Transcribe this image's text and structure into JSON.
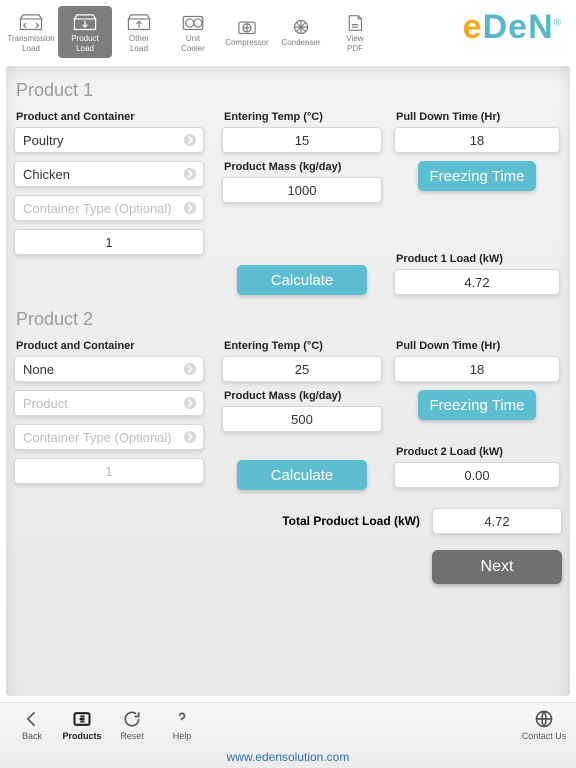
{
  "tabs": [
    {
      "l1": "Transmission",
      "l2": "Load"
    },
    {
      "l1": "Product",
      "l2": "Load"
    },
    {
      "l1": "Other",
      "l2": "Load"
    },
    {
      "l1": "Unit",
      "l2": "Cooler"
    },
    {
      "l1": "Compressor",
      "l2": ""
    },
    {
      "l1": "Condenser",
      "l2": ""
    },
    {
      "l1": "View",
      "l2": "PDF"
    }
  ],
  "active_tab": 1,
  "brand": "eDeN",
  "p1": {
    "title": "Product 1",
    "pc_label": "Product and Container",
    "category": "Poultry",
    "product": "Chicken",
    "container_placeholder": "Container Type (Optional)",
    "qty": "1",
    "et_label": "Entering Temp (°C)",
    "et": "15",
    "pm_label": "Product Mass (kg/day)",
    "pm": "1000",
    "pd_label": "Pull Down Time (Hr)",
    "pd": "18",
    "freeze_btn": "Freezing Time",
    "calc_btn": "Calculate",
    "load_label": "Product 1 Load (kW)",
    "load": "4.72"
  },
  "p2": {
    "title": "Product 2",
    "pc_label": "Product and Container",
    "category": "None",
    "product_placeholder": "Product",
    "container_placeholder": "Container Type (Optional)",
    "qty": "1",
    "et_label": "Entering Temp (°C)",
    "et": "25",
    "pm_label": "Product Mass (kg/day)",
    "pm": "500",
    "pd_label": "Pull Down Time (Hr)",
    "pd": "18",
    "freeze_btn": "Freezing Time",
    "calc_btn": "Calculate",
    "load_label": "Product 2 Load (kW)",
    "load": "0.00"
  },
  "total_label": "Total Product Load (kW)",
  "total_value": "4.72",
  "next": "Next",
  "bottom": {
    "back": "Back",
    "products": "Products",
    "reset": "Reset",
    "help": "Help",
    "contact": "Contact Us"
  },
  "site": "www.edensolution.com"
}
